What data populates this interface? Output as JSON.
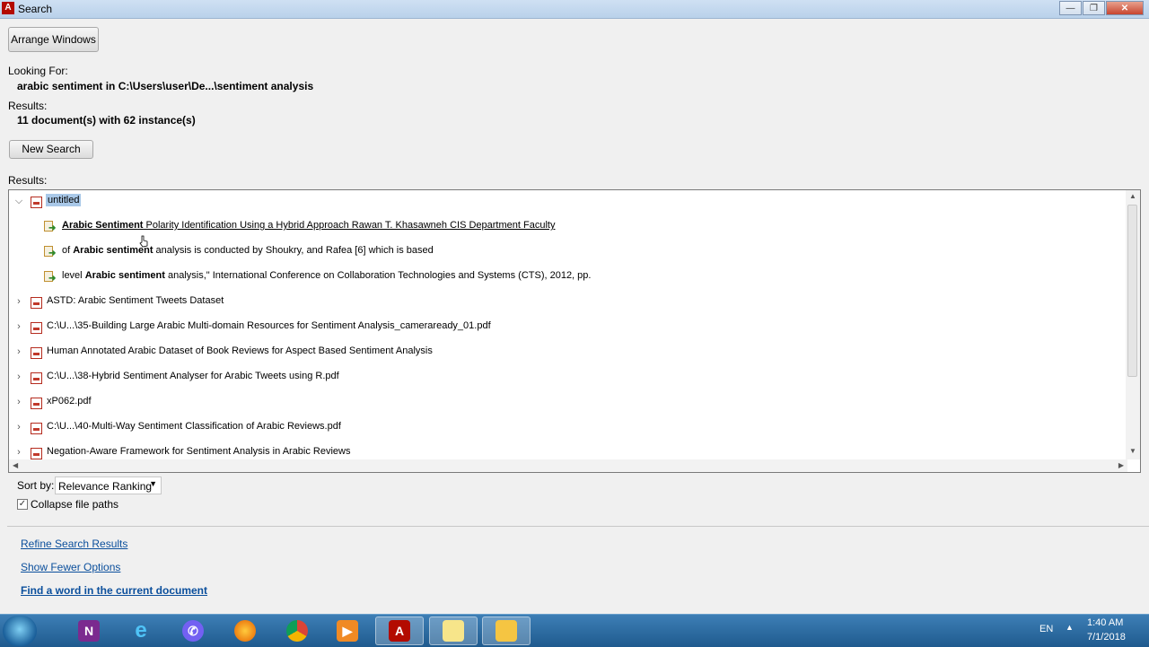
{
  "window": {
    "title": "Search",
    "minimize": "—",
    "maximize": "❐",
    "close": "✕"
  },
  "toolbar": {
    "arrange_label": "Arrange Windows"
  },
  "looking_for": {
    "label": "Looking For:",
    "value": "arabic sentiment in C:\\Users\\user\\De...\\sentiment analysis"
  },
  "results_summary": {
    "label": "Results:",
    "value": "11 document(s) with 62 instance(s)"
  },
  "new_search_label": "New Search",
  "results_tree_label": "Results:",
  "tree": {
    "expanded": {
      "title": "untitled",
      "hits": [
        {
          "pre": "",
          "bold": "Arabic Sentiment",
          "post": " Polarity Identification Using a Hybrid Approach Rawan T. Khasawneh CIS Department Faculty"
        },
        {
          "pre": "of ",
          "bold": "Arabic sentiment",
          "post": " analysis is conducted by Shoukry, and Rafea [6] which is based"
        },
        {
          "pre": "level ",
          "bold": "Arabic sentiment",
          "post": " analysis,\" International Conference on Collaboration Technologies and Systems (CTS), 2012, pp."
        }
      ]
    },
    "documents": [
      "ASTD: Arabic Sentiment Tweets Dataset",
      "C:\\U...\\35-Building Large Arabic Multi-domain Resources for Sentiment Analysis_cameraready_01.pdf",
      "Human Annotated Arabic Dataset of Book Reviews for Aspect Based Sentiment Analysis",
      "C:\\U...\\38-Hybrid Sentiment Analyser for Arabic Tweets using R.pdf",
      "xP062.pdf",
      "C:\\U...\\40-Multi-Way Sentiment Classification of Arabic Reviews.pdf",
      "Negation-Aware Framework for Sentiment Analysis in Arabic Reviews"
    ]
  },
  "sort": {
    "label": "Sort by:",
    "value": "Relevance Ranking"
  },
  "collapse": {
    "label": "Collapse file paths",
    "checked": true
  },
  "links": {
    "refine": "Refine Search Results",
    "fewer": "Show Fewer Options",
    "find": "Find a word in the current document"
  },
  "taskbar": {
    "apps": [
      "onenote-icon",
      "internet-explorer-icon",
      "viber-icon",
      "firefox-icon",
      "chrome-icon",
      "media-player-icon",
      "acrobat-icon",
      "sticky-notes-icon",
      "file-explorer-icon"
    ],
    "language": "EN",
    "time": "1:40 AM",
    "date": "7/1/2018"
  }
}
